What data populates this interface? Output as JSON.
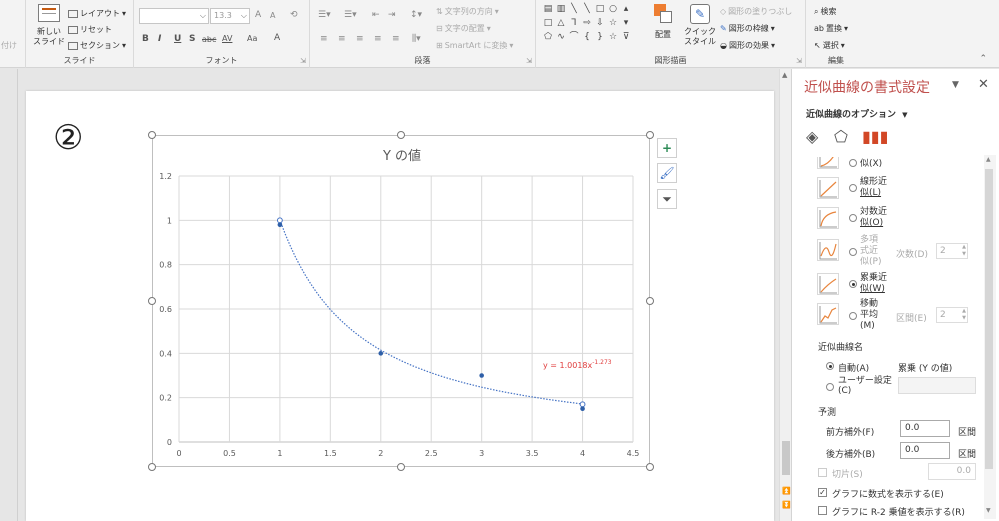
{
  "ribbon": {
    "clipboard_partial": "付け",
    "slides": {
      "new_slide": "新しい",
      "new_slide2": "スライド",
      "layout": "レイアウト",
      "reset": "リセット",
      "section": "セクション",
      "group_label": "スライド"
    },
    "font": {
      "font_name": "",
      "font_size": "13.3",
      "bold": "B",
      "italic": "I",
      "underline": "U",
      "shadow": "S",
      "strike": "abc",
      "spacing": "AV",
      "case": "Aa",
      "color": "A",
      "grow": "A",
      "shrink": "A",
      "group_label": "フォント"
    },
    "paragraph": {
      "text_direction": "文字列の方向",
      "align_text": "文字の配置",
      "smartart": "SmartArt に変換",
      "group_label": "段落"
    },
    "drawing": {
      "arrange": "配置",
      "quick_style": "クイック",
      "quick_style2": "スタイル",
      "shape_fill": "図形の塗りつぶし",
      "shape_outline": "図形の枠線",
      "shape_effects": "図形の効果",
      "group_label": "図形描画"
    },
    "editing": {
      "find": "検索",
      "replace": "置換",
      "select": "選択",
      "group_label": "編集"
    }
  },
  "slide": {
    "circled_number": "②"
  },
  "chart_data": {
    "type": "scatter",
    "title": "Y の値",
    "xlabel": "",
    "ylabel": "",
    "xlim": [
      0,
      4.5
    ],
    "ylim": [
      0,
      1.2
    ],
    "x_ticks": [
      "0",
      "0.5",
      "1",
      "1.5",
      "2",
      "2.5",
      "3",
      "3.5",
      "4",
      "4.5"
    ],
    "y_ticks": [
      "0",
      "0.2",
      "0.4",
      "0.6",
      "0.8",
      "1",
      "1.2"
    ],
    "grid": true,
    "series": [
      {
        "values_x": [
          1,
          2,
          3,
          4
        ],
        "values_y": [
          0.98,
          0.4,
          0.3,
          0.15
        ]
      }
    ],
    "trendline": {
      "kind": "power",
      "a": 1.0018,
      "b": -1.273,
      "fit_points_x": [
        1,
        4
      ],
      "fit_points_y": [
        1.0,
        0.17
      ],
      "equation_label": "y = 1.0018x",
      "equation_exp": "-1.273",
      "line_color": "#4472c4",
      "label_color": "#e03c3c"
    },
    "point_color": "#2e5fa8"
  },
  "chart_tools": {
    "add_element": "+",
    "styles": "",
    "filter": ""
  },
  "pane": {
    "title": "近似曲線の書式設定",
    "options_label": "近似曲線のオプション",
    "trend_types": [
      {
        "label1": "",
        "label2": "似(X)",
        "checked": false
      },
      {
        "label1": "線形近",
        "label2": "似(L)",
        "checked": false
      },
      {
        "label1": "対数近",
        "label2": "似(O)",
        "checked": false
      },
      {
        "label1": "多項",
        "label2": "式近",
        "label3": "似(P)",
        "checked": false,
        "extra": "次数(D)",
        "extra_value": "2"
      },
      {
        "label1": "累乗近",
        "label2": "似(W)",
        "checked": true
      },
      {
        "label1": "移動",
        "label2": "平均",
        "label3": "(M)",
        "checked": false,
        "extra": "区間(E)",
        "extra_value": "2"
      }
    ],
    "name_section": "近似曲線名",
    "auto_label": "自動(A)",
    "auto_value": "累乗 (Y の値)",
    "user_label": "ユーザー設定",
    "user_label2": "(C)",
    "forecast_section": "予測",
    "forward_label": "前方補外(F)",
    "forward_value": "0.0",
    "forward_unit": "区間",
    "backward_label": "後方補外(B)",
    "backward_value": "0.0",
    "backward_unit": "区間",
    "intercept_label": "切片(S)",
    "intercept_value": "0.0",
    "show_equation_label": "グラフに数式を表示する(E)",
    "show_r2_label": "グラフに R-2 乗値を表示する(R)"
  }
}
